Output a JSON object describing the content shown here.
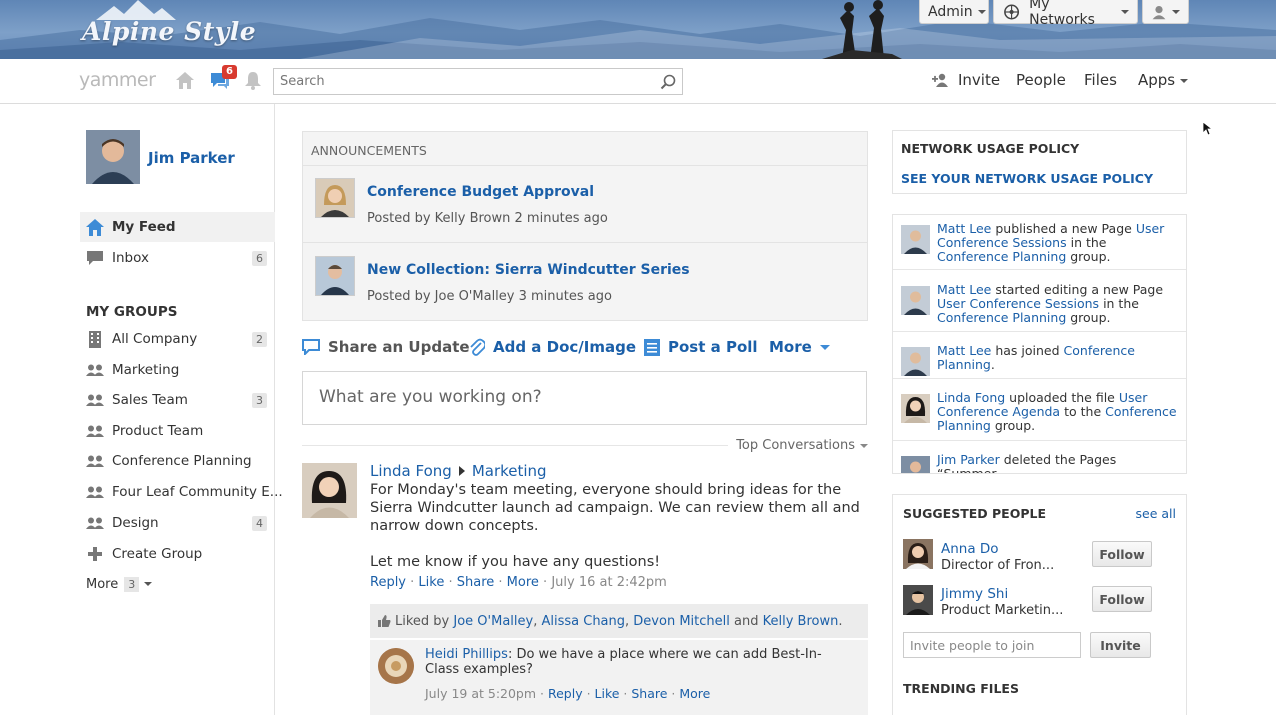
{
  "banner": {
    "brand": "Alpine Style",
    "admin_label": "Admin",
    "networks_label": "My Networks"
  },
  "nav": {
    "logo": "yammer",
    "notification_count": "6",
    "search_placeholder": "Search",
    "invite": "Invite",
    "people": "People",
    "files": "Files",
    "apps": "Apps"
  },
  "sidebar": {
    "user_name": "Jim Parker",
    "my_feed": "My Feed",
    "inbox": {
      "label": "Inbox",
      "count": "6"
    },
    "groups_heading": "MY GROUPS",
    "groups": [
      {
        "label": "All Company",
        "count": "2",
        "icon": "building-icon"
      },
      {
        "label": "Marketing",
        "count": "",
        "icon": "group-icon"
      },
      {
        "label": "Sales Team",
        "count": "3",
        "icon": "group-icon"
      },
      {
        "label": "Product Team",
        "count": "",
        "icon": "group-icon"
      },
      {
        "label": "Conference Planning",
        "count": "",
        "icon": "group-icon"
      },
      {
        "label": "Four Leaf Community E...",
        "count": "",
        "icon": "group-icon"
      },
      {
        "label": "Design",
        "count": "4",
        "icon": "group-icon"
      }
    ],
    "create_group": "Create Group",
    "more": {
      "label": "More",
      "count": "3"
    }
  },
  "announcements": {
    "heading": "ANNOUNCEMENTS",
    "items": [
      {
        "title": "Conference Budget Approval",
        "posted_by": "Posted by Kelly Brown 2 minutes ago"
      },
      {
        "title": "New Collection: Sierra Windcutter Series",
        "posted_by": "Posted by Joe O'Malley 3 minutes ago"
      }
    ]
  },
  "composer": {
    "tabs": [
      "Share an Update",
      "Add a Doc/Image",
      "Post a Poll",
      "More"
    ],
    "placeholder": "What are you working on?"
  },
  "feed": {
    "sort_label": "Top Conversations",
    "post": {
      "author": "Linda Fong",
      "group": "Marketing",
      "body_line1": "For Monday's team meeting, everyone should bring ideas for the Sierra Windcutter launch ad campaign. We can review them all and narrow down concepts.",
      "body_line2": "Let me know if you have any questions!",
      "actions": [
        "Reply",
        "Like",
        "Share",
        "More"
      ],
      "timestamp": "July 16 at 2:42pm",
      "liked_prefix": "Liked by",
      "liked_names": [
        "Joe O'Malley",
        "Alissa Chang",
        "Devon Mitchell"
      ],
      "liked_and": "and",
      "liked_last": "Kelly Brown",
      "reply": {
        "author": "Heidi Phillips",
        "text": "Do we have a place where we can add Best-In-Class examples?",
        "timestamp": "July 19 at 5:20pm",
        "actions": [
          "Reply",
          "Like",
          "Share",
          "More"
        ]
      }
    }
  },
  "right": {
    "policy_heading": "NETWORK USAGE POLICY",
    "policy_link": "SEE YOUR NETWORK USAGE POLICY",
    "activity": [
      {
        "actor": "Matt Lee",
        "verb": "published a new Page",
        "object": "User Conference Sessions",
        "mid": "in the",
        "target": "Conference Planning",
        "tail": "group."
      },
      {
        "actor": "Matt Lee",
        "verb": "started editing a new Page",
        "object": "User Conference Sessions",
        "mid": "in the",
        "target": "Conference Planning",
        "tail": "group."
      },
      {
        "actor": "Matt Lee",
        "verb": "has joined",
        "object": "Conference Planning",
        "mid": "",
        "target": "",
        "tail": "."
      },
      {
        "actor": "Linda Fong",
        "verb": "uploaded the file",
        "object": "User Conference Agenda",
        "mid": "to the",
        "target": "Conference Planning",
        "tail": "group."
      },
      {
        "actor": "Jim Parker",
        "verb": "deleted the Pages “Summer",
        "object": "",
        "mid": "",
        "target": "",
        "tail": ""
      }
    ],
    "suggested_heading": "SUGGESTED PEOPLE",
    "see_all": "see all",
    "people": [
      {
        "name": "Anna Do",
        "title": "Director of Fron...",
        "button": "Follow"
      },
      {
        "name": "Jimmy Shi",
        "title": "Product Marketin...",
        "button": "Follow"
      }
    ],
    "invite_placeholder": "Invite people to join",
    "invite_button": "Invite",
    "trending_heading": "TRENDING FILES"
  }
}
